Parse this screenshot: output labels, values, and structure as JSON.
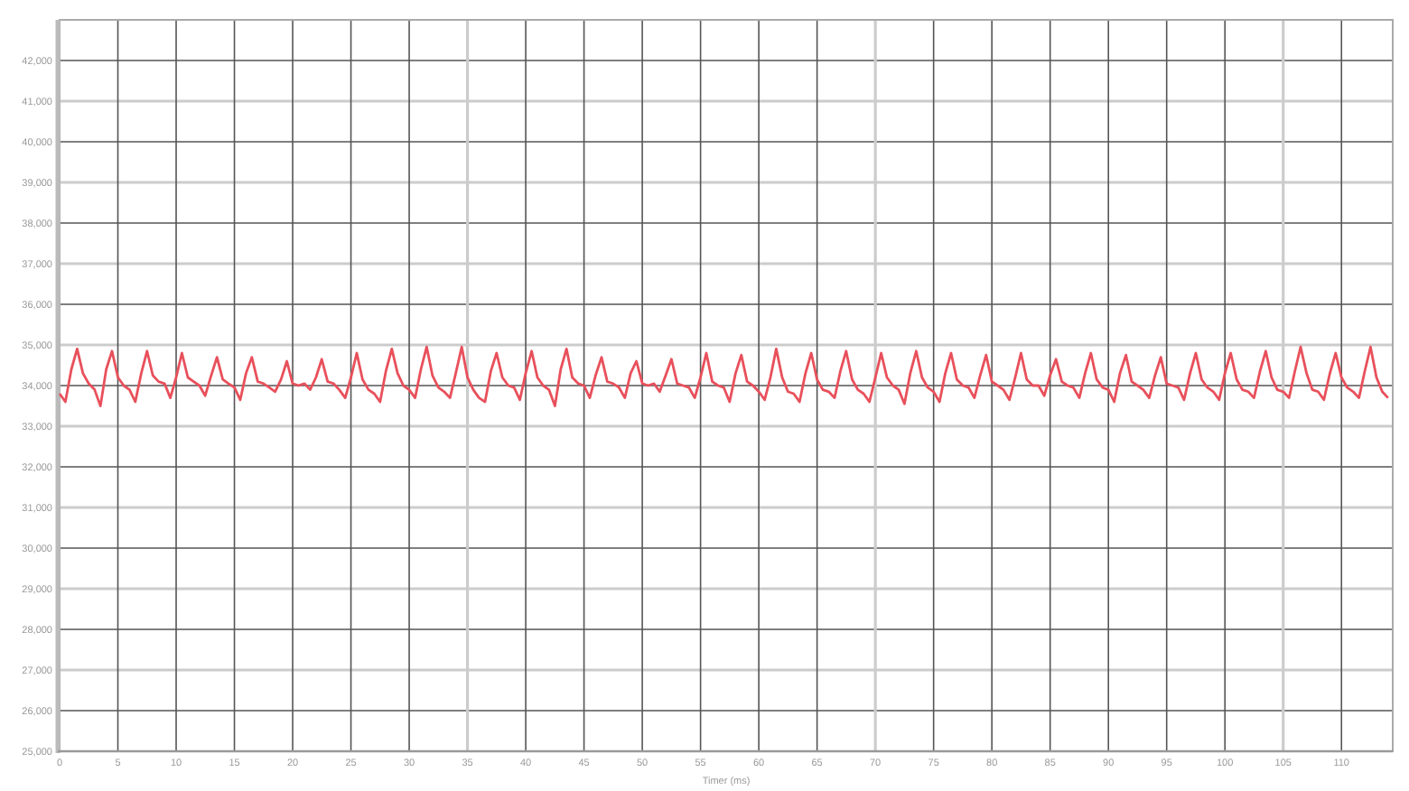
{
  "chart_data": {
    "type": "line",
    "grid": true,
    "xlabel": "Timer (ms)",
    "xlim": [
      0,
      114.4
    ],
    "ylim": [
      25000,
      43000
    ],
    "xticks": [
      0,
      5,
      10,
      15,
      20,
      25,
      30,
      35,
      40,
      45,
      50,
      55,
      60,
      65,
      70,
      75,
      80,
      85,
      90,
      95,
      100,
      105,
      110
    ],
    "yticks": [
      {
        "value": 25000,
        "label": "25,000"
      },
      {
        "value": 26000,
        "label": "26,000"
      },
      {
        "value": 27000,
        "label": "27,000"
      },
      {
        "value": 28000,
        "label": "28,000"
      },
      {
        "value": 29000,
        "label": "29,000"
      },
      {
        "value": 30000,
        "label": "30,000"
      },
      {
        "value": 31000,
        "label": "31,000"
      },
      {
        "value": 32000,
        "label": "32,000"
      },
      {
        "value": 33000,
        "label": "33,000"
      },
      {
        "value": 34000,
        "label": "34,000"
      },
      {
        "value": 35000,
        "label": "35,000"
      },
      {
        "value": 36000,
        "label": "36,000"
      },
      {
        "value": 37000,
        "label": "37,000"
      },
      {
        "value": 38000,
        "label": "38,000"
      },
      {
        "value": 39000,
        "label": "39,000"
      },
      {
        "value": 40000,
        "label": "40,000"
      },
      {
        "value": 41000,
        "label": "41,000"
      },
      {
        "value": 42000,
        "label": "42,000"
      }
    ],
    "x": [
      0,
      0.5,
      1,
      1.5,
      2,
      2.5,
      3,
      3.5,
      4,
      4.5,
      5,
      5.5,
      6,
      6.5,
      7,
      7.5,
      8,
      8.5,
      9,
      9.5,
      10,
      10.5,
      11,
      11.5,
      12,
      12.5,
      13,
      13.5,
      14,
      14.5,
      15,
      15.5,
      16,
      16.5,
      17,
      17.5,
      18,
      18.5,
      19,
      19.5,
      20,
      20.5,
      21,
      21.5,
      22,
      22.5,
      23,
      23.5,
      24,
      24.5,
      25,
      25.5,
      26,
      26.5,
      27,
      27.5,
      28,
      28.5,
      29,
      29.5,
      30,
      30.5,
      31,
      31.5,
      32,
      32.5,
      33,
      33.5,
      34,
      34.5,
      35,
      35.5,
      36,
      36.5,
      37,
      37.5,
      38,
      38.5,
      39,
      39.5,
      40,
      40.5,
      41,
      41.5,
      42,
      42.5,
      43,
      43.5,
      44,
      44.5,
      45,
      45.5,
      46,
      46.5,
      47,
      47.5,
      48,
      48.5,
      49,
      49.5,
      50,
      50.5,
      51,
      51.5,
      52,
      52.5,
      53,
      53.5,
      54,
      54.5,
      55,
      55.5,
      56,
      56.5,
      57,
      57.5,
      58,
      58.5,
      59,
      59.5,
      60,
      60.5,
      61,
      61.5,
      62,
      62.5,
      63,
      63.5,
      64,
      64.5,
      65,
      65.5,
      66,
      66.5,
      67,
      67.5,
      68,
      68.5,
      69,
      69.5,
      70,
      70.5,
      71,
      71.5,
      72,
      72.5,
      73,
      73.5,
      74,
      74.5,
      75,
      75.5,
      76,
      76.5,
      77,
      77.5,
      78,
      78.5,
      79,
      79.5,
      80,
      80.5,
      81,
      81.5,
      82,
      82.5,
      83,
      83.5,
      84,
      84.5,
      85,
      85.5,
      86,
      86.5,
      87,
      87.5,
      88,
      88.5,
      89,
      89.5,
      90,
      90.5,
      91,
      91.5,
      92,
      92.5,
      93,
      93.5,
      94,
      94.5,
      95,
      95.5,
      96,
      96.5,
      97,
      97.5,
      98,
      98.5,
      99,
      99.5,
      100,
      100.5,
      101,
      101.5,
      102,
      102.5,
      103,
      103.5,
      104,
      104.5,
      105,
      105.5,
      106,
      106.5,
      107,
      107.5,
      108,
      108.5,
      109,
      109.5,
      110,
      110.5,
      111,
      111.5,
      112,
      112.5,
      113,
      113.5,
      114
    ],
    "series": [
      {
        "color": "#e8505b",
        "values": [
          33800,
          33600,
          34400,
          34900,
          34300,
          34050,
          33900,
          33500,
          34400,
          34850,
          34200,
          34000,
          33900,
          33600,
          34300,
          34850,
          34250,
          34100,
          34050,
          33700,
          34200,
          34800,
          34200,
          34100,
          34000,
          33750,
          34250,
          34700,
          34150,
          34050,
          33950,
          33650,
          34300,
          34700,
          34100,
          34050,
          33950,
          33850,
          34150,
          34600,
          34050,
          34000,
          34050,
          33900,
          34200,
          34650,
          34100,
          34050,
          33900,
          33700,
          34200,
          34800,
          34150,
          33900,
          33800,
          33600,
          34350,
          34900,
          34300,
          34000,
          33900,
          33700,
          34400,
          34950,
          34250,
          33950,
          33850,
          33700,
          34300,
          34950,
          34200,
          33900,
          33700,
          33600,
          34350,
          34800,
          34200,
          34000,
          33950,
          33650,
          34300,
          34850,
          34200,
          34000,
          33900,
          33500,
          34400,
          34900,
          34200,
          34050,
          34000,
          33700,
          34250,
          34700,
          34100,
          34050,
          33950,
          33700,
          34300,
          34600,
          34050,
          34000,
          34050,
          33850,
          34250,
          34650,
          34050,
          34000,
          33950,
          33700,
          34200,
          34800,
          34100,
          34000,
          33950,
          33600,
          34300,
          34750,
          34100,
          34000,
          33850,
          33650,
          34200,
          34900,
          34200,
          33850,
          33800,
          33600,
          34300,
          34800,
          34150,
          33900,
          33850,
          33700,
          34350,
          34850,
          34150,
          33900,
          33800,
          33600,
          34200,
          34800,
          34200,
          34000,
          33900,
          33550,
          34300,
          34850,
          34200,
          33950,
          33850,
          33600,
          34300,
          34800,
          34150,
          34000,
          33950,
          33700,
          34250,
          34750,
          34100,
          34000,
          33900,
          33650,
          34200,
          34800,
          34150,
          34000,
          34000,
          33750,
          34250,
          34650,
          34100,
          34000,
          33950,
          33700,
          34300,
          34800,
          34150,
          33950,
          33900,
          33600,
          34300,
          34750,
          34100,
          34000,
          33900,
          33700,
          34250,
          34700,
          34050,
          34000,
          33950,
          33650,
          34300,
          34800,
          34150,
          33950,
          33850,
          33650,
          34300,
          34800,
          34150,
          33900,
          33850,
          33700,
          34350,
          34850,
          34200,
          33900,
          33850,
          33700,
          34350,
          34950,
          34300,
          33900,
          33850,
          33650,
          34300,
          34800,
          34200,
          33950,
          33850,
          33700,
          34350,
          34950,
          34200,
          33850,
          33700
        ]
      }
    ]
  }
}
